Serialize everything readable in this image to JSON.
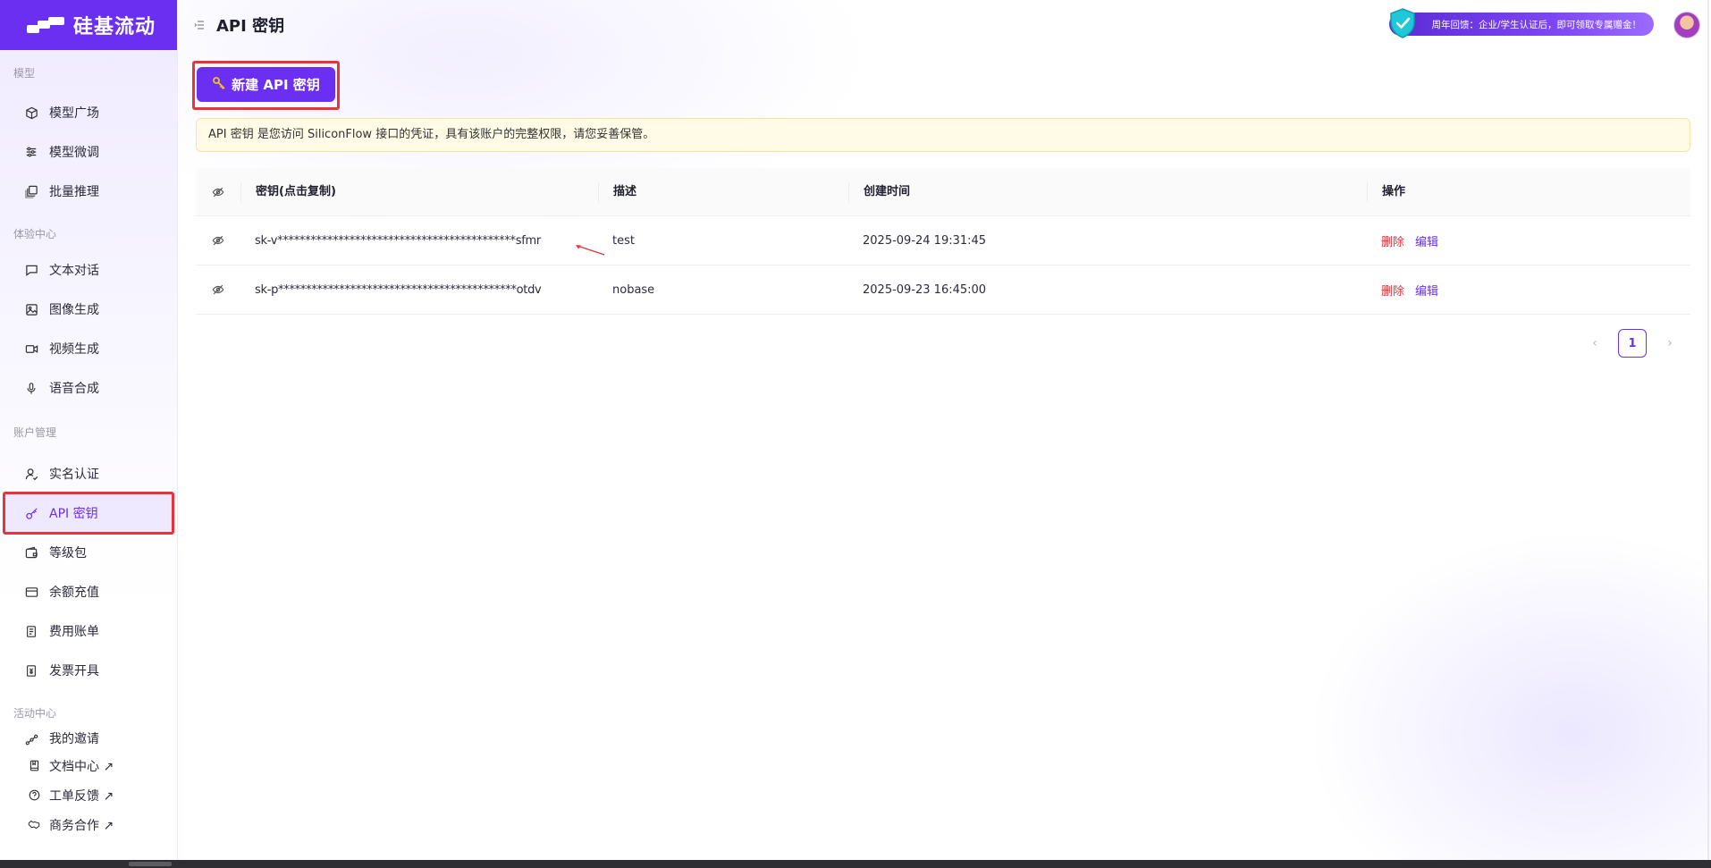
{
  "app": {
    "brand": "硅基流动"
  },
  "sidebar": {
    "groups": [
      {
        "title": "模型",
        "items": [
          {
            "label": "模型广场",
            "icon": "cube-icon"
          },
          {
            "label": "模型微调",
            "icon": "sliders-icon"
          },
          {
            "label": "批量推理",
            "icon": "layers-icon"
          }
        ]
      },
      {
        "title": "体验中心",
        "items": [
          {
            "label": "文本对话",
            "icon": "chat-icon"
          },
          {
            "label": "图像生成",
            "icon": "image-icon"
          },
          {
            "label": "视频生成",
            "icon": "video-icon"
          },
          {
            "label": "语音合成",
            "icon": "mic-icon"
          }
        ]
      },
      {
        "title": "账户管理",
        "items": [
          {
            "label": "实名认证",
            "icon": "user-check-icon"
          },
          {
            "label": "API 密钥",
            "icon": "key-icon",
            "active": true
          },
          {
            "label": "等级包",
            "icon": "wallet-icon"
          },
          {
            "label": "余额充值",
            "icon": "credit-card-icon"
          },
          {
            "label": "费用账单",
            "icon": "receipt-icon"
          },
          {
            "label": "发票开具",
            "icon": "invoice-icon"
          }
        ]
      },
      {
        "title": "活动中心",
        "items": [
          {
            "label": "我的邀请",
            "icon": "share-icon"
          }
        ]
      }
    ],
    "external_links": [
      {
        "label": "文档中心 ↗",
        "icon": "book-icon"
      },
      {
        "label": "工单反馈 ↗",
        "icon": "help-icon"
      },
      {
        "label": "商务合作 ↗",
        "icon": "handshake-icon"
      }
    ]
  },
  "header": {
    "title": "API 密钥",
    "promo_text": "周年回馈：企业/学生认证后，即可领取专属赠金！"
  },
  "main": {
    "new_key_label": "新建 API 密钥",
    "notice": "API 密钥 是您访问 SiliconFlow 接口的凭证，具有该账户的完整权限，请您妥善保管。",
    "table": {
      "columns": [
        "密钥(点击复制)",
        "描述",
        "创建时间",
        "操作"
      ],
      "rows": [
        {
          "key": "sk-v*******************************************sfmr",
          "description": "test",
          "created": "2025-09-24 19:31:45",
          "delete": "删除",
          "edit": "编辑"
        },
        {
          "key": "sk-p*******************************************otdv",
          "description": "nobase",
          "created": "2025-09-23 16:45:00",
          "delete": "删除",
          "edit": "编辑"
        }
      ]
    },
    "pagination": {
      "current": "1"
    }
  },
  "colors": {
    "accent": "#6a2ff0",
    "danger": "#e8323c",
    "notice_bg": "#fffbe6"
  }
}
